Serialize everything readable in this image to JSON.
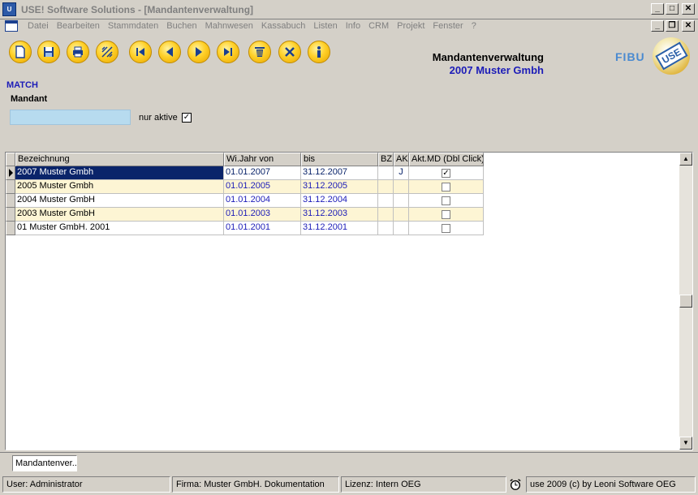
{
  "window": {
    "title": "USE! Software Solutions - [Mandantenverwaltung]",
    "app_icon": "use-app-icon"
  },
  "menu": [
    "Datei",
    "Bearbeiten",
    "Stammdaten",
    "Buchen",
    "Mahnwesen",
    "Kassabuch",
    "Listen",
    "Info",
    "CRM",
    "Projekt",
    "Fenster",
    "?"
  ],
  "toolbar": {
    "buttons": [
      {
        "name": "new-document-icon"
      },
      {
        "name": "save-icon"
      },
      {
        "name": "print-icon"
      },
      {
        "name": "search-beam-icon"
      },
      {
        "name": "first-record-icon"
      },
      {
        "name": "previous-record-icon"
      },
      {
        "name": "next-record-icon"
      },
      {
        "name": "last-record-icon"
      },
      {
        "name": "delete-icon"
      },
      {
        "name": "close-x-icon"
      },
      {
        "name": "info-icon"
      }
    ]
  },
  "header": {
    "title": "Mandantenverwaltung",
    "subtitle": "2007 Muster Gmbh",
    "module": "FIBU",
    "logo_text": "USE"
  },
  "filter": {
    "match_label": "MATCH",
    "mandant_label": "Mandant",
    "mandant_value": "",
    "nur_aktive_label": "nur aktive",
    "nur_aktive_checked": true
  },
  "grid": {
    "columns": [
      "Bezeichnung",
      "Wi.Jahr von",
      "bis",
      "BZ",
      "AK",
      "Akt.MD (Dbl Click)"
    ],
    "rows": [
      {
        "bezeichnung": "2007 Muster Gmbh",
        "von": "01.01.2007",
        "bis": "31.12.2007",
        "bz": "",
        "ak": "J",
        "akt": true
      },
      {
        "bezeichnung": "2005 Muster Gmbh",
        "von": "01.01.2005",
        "bis": "31.12.2005",
        "bz": "",
        "ak": "",
        "akt": false
      },
      {
        "bezeichnung": "2004 Muster GmbH",
        "von": "01.01.2004",
        "bis": "31.12.2004",
        "bz": "",
        "ak": "",
        "akt": false
      },
      {
        "bezeichnung": "2003 Muster GmbH",
        "von": "01.01.2003",
        "bis": "31.12.2003",
        "bz": "",
        "ak": "",
        "akt": false
      },
      {
        "bezeichnung": "01 Muster GmbH. 2001",
        "von": "01.01.2001",
        "bis": "31.12.2001",
        "bz": "",
        "ak": "",
        "akt": false
      }
    ]
  },
  "taskbar": {
    "tab": "Mandantenver..."
  },
  "status": {
    "user": "User: Administrator",
    "firma": "Firma: Muster GmbH. Dokumentation",
    "lizenz": "Lizenz: Intern OEG",
    "copyright": "use 2009 (c) by Leoni Software OEG"
  },
  "colors": {
    "selection": "#0a246a",
    "alt_row": "#fdf5d4",
    "input_bg": "#b7dbef",
    "title_blue": "#1c1cb8"
  }
}
